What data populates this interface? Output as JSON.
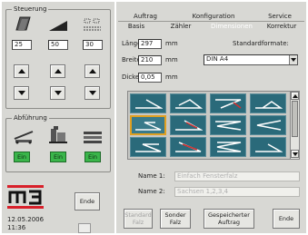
{
  "steuerung": {
    "legend": "Steuerung",
    "values": [
      "25",
      "50",
      "30"
    ]
  },
  "abfuehrung": {
    "legend": "Abführung",
    "buttons": [
      "Ein",
      "Ein",
      "Ein"
    ]
  },
  "logo": {
    "text": "m3"
  },
  "ende_left": "Ende",
  "datetime": {
    "date": "12.05.2006",
    "time": "11:36"
  },
  "tabs_top": [
    "Auftrag",
    "Konfiguration",
    "Service"
  ],
  "tabs_bottom": [
    "Basis",
    "Zähler",
    "Dimensionen",
    "Korrektur"
  ],
  "form": {
    "laenge_label": "Länge:",
    "laenge_value": "297",
    "laenge_unit": "mm",
    "breite_label": "Breite:",
    "breite_value": "210",
    "breite_unit": "mm",
    "dicke_label": "Dicke:",
    "dicke_value": "0,05",
    "dicke_unit": "mm",
    "standard_label": "Standardformate:",
    "standard_value": "DIN A4"
  },
  "names": {
    "name1_label": "Name 1:",
    "name1_value": "Einfach Fensterfalz",
    "name2_label": "Name 2:",
    "name2_value": "Sachsen 1,2,3,4"
  },
  "bottom_buttons": {
    "standard": "Standard Falz",
    "sonder": "Sonder Falz",
    "gespeichert": "Gespeicherter Auftrag",
    "ende": "Ende"
  },
  "colors": {
    "panel": "#d8d8d4",
    "thumb": "#2a6a7a",
    "selected": "#e0a020",
    "green": "#3ab54a",
    "logo_red": "#d8202a"
  }
}
